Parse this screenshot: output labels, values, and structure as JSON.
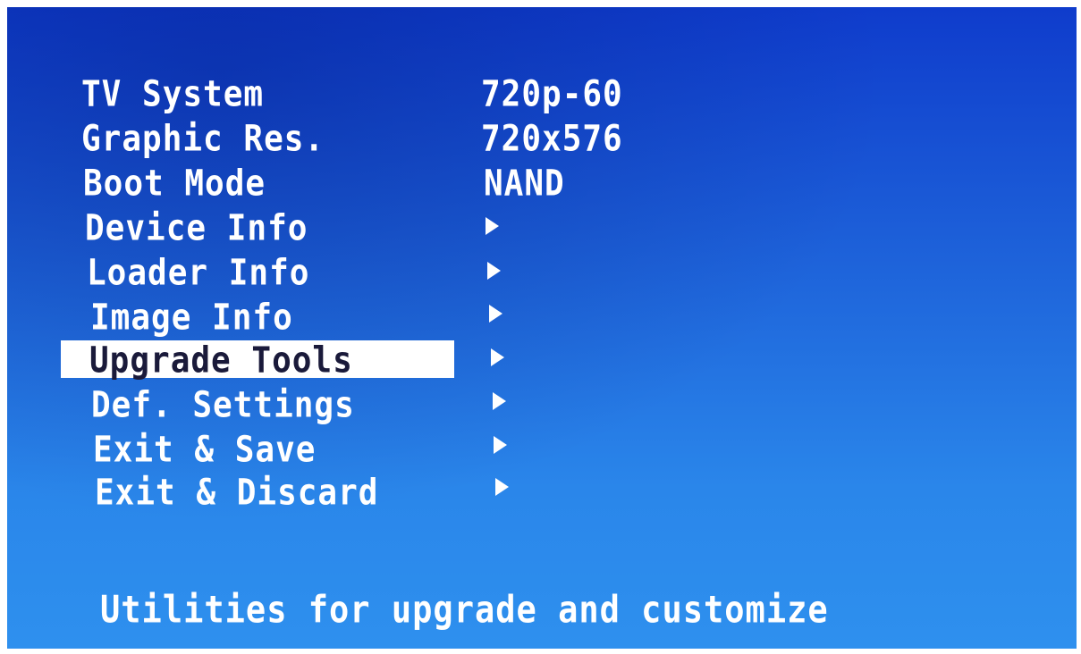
{
  "menu": {
    "items": [
      {
        "label": "TV System",
        "value": "720p-60"
      },
      {
        "label": "Graphic Res.",
        "value": "720x576"
      },
      {
        "label": "Boot Mode",
        "value": "NAND"
      },
      {
        "label": "Device Info",
        "arrow_icon": "triangle-right"
      },
      {
        "label": "Loader Info",
        "arrow_icon": "triangle-right"
      },
      {
        "label": "Image Info",
        "arrow_icon": "triangle-right"
      },
      {
        "label": "Upgrade Tools",
        "arrow_icon": "triangle-right",
        "selected": true
      },
      {
        "label": "Def. Settings",
        "arrow_icon": "triangle-right"
      },
      {
        "label": "Exit & Save",
        "arrow_icon": "triangle-right"
      },
      {
        "label": "Exit & Discard",
        "arrow_icon": "triangle-right"
      }
    ]
  },
  "footer": {
    "description": "Utilities for upgrade and customize"
  },
  "colors": {
    "background": "#1c5ed8",
    "text": "#ffffff",
    "highlight": "#ffffff",
    "selected_text": "#1a1a3a"
  }
}
